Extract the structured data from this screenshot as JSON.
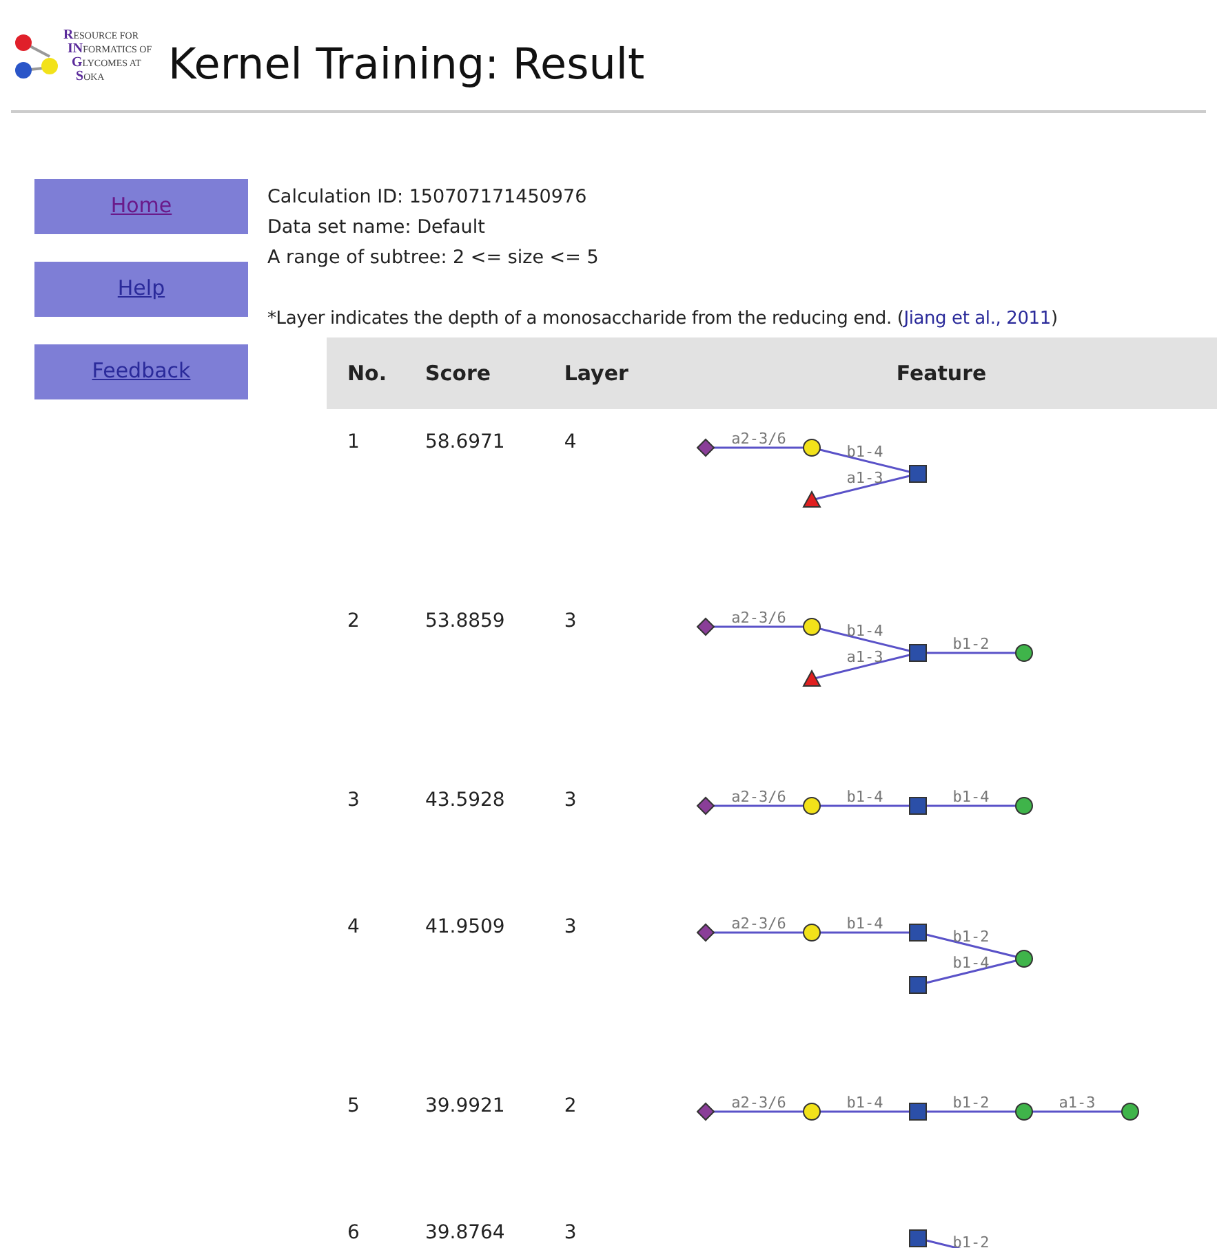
{
  "logo": {
    "lines": [
      {
        "lead": "R",
        "rest": "ESOURCE FOR"
      },
      {
        "lead": "IN",
        "rest": "FORMATICS OF"
      },
      {
        "lead": "G",
        "rest": "LYCOMES AT"
      },
      {
        "lead": "S",
        "rest": "OKA"
      }
    ]
  },
  "title": "Kernel Training: Result",
  "nav": [
    "Home",
    "Help",
    "Feedback"
  ],
  "info": [
    "Calculation ID: 150707171450976",
    "Data set name: Default",
    "A range of subtree: 2 <= size <= 5"
  ],
  "note": {
    "text": "*Layer indicates the depth of a monosaccharide from the reducing end. (",
    "link": "Jiang et al., 2011",
    "after": ")"
  },
  "table": {
    "columns": [
      "No.",
      "Score",
      "Layer",
      "Feature"
    ],
    "rows": [
      {
        "no": "1",
        "score": "58.6971",
        "layer": "4",
        "feature": {
          "tree": {
            "kind": "square",
            "children": [
              {
                "kind": "circle",
                "color": "#f2e21a",
                "link": "b1-4",
                "children": [
                  {
                    "kind": "diamond",
                    "link": "a2-3/6"
                  }
                ]
              },
              {
                "kind": "triangle",
                "link": "a1-3"
              }
            ]
          }
        }
      },
      {
        "no": "2",
        "score": "53.8859",
        "layer": "3",
        "feature": {
          "tree": {
            "kind": "circle",
            "color": "#3fb44a",
            "children": [
              {
                "kind": "square",
                "link": "b1-2",
                "children": [
                  {
                    "kind": "circle",
                    "color": "#f2e21a",
                    "link": "b1-4",
                    "children": [
                      {
                        "kind": "diamond",
                        "link": "a2-3/6"
                      }
                    ]
                  },
                  {
                    "kind": "triangle",
                    "link": "a1-3"
                  }
                ]
              }
            ]
          }
        }
      },
      {
        "no": "3",
        "score": "43.5928",
        "layer": "3",
        "feature": {
          "tree": {
            "kind": "circle",
            "color": "#3fb44a",
            "children": [
              {
                "kind": "square",
                "link": "b1-4",
                "children": [
                  {
                    "kind": "circle",
                    "color": "#f2e21a",
                    "link": "b1-4",
                    "children": [
                      {
                        "kind": "diamond",
                        "link": "a2-3/6"
                      }
                    ]
                  }
                ]
              }
            ]
          }
        }
      },
      {
        "no": "4",
        "score": "41.9509",
        "layer": "3",
        "feature": {
          "tree": {
            "kind": "circle",
            "color": "#3fb44a",
            "children": [
              {
                "kind": "square",
                "link": "b1-2",
                "children": [
                  {
                    "kind": "circle",
                    "color": "#f2e21a",
                    "link": "b1-4",
                    "children": [
                      {
                        "kind": "diamond",
                        "link": "a2-3/6"
                      }
                    ]
                  }
                ]
              },
              {
                "kind": "square",
                "link": "b1-4"
              }
            ]
          }
        }
      },
      {
        "no": "5",
        "score": "39.9921",
        "layer": "2",
        "feature": {
          "tree": {
            "kind": "circle",
            "color": "#3fb44a",
            "children": [
              {
                "kind": "circle",
                "color": "#3fb44a",
                "link": "a1-3",
                "children": [
                  {
                    "kind": "square",
                    "link": "b1-2",
                    "children": [
                      {
                        "kind": "circle",
                        "color": "#f2e21a",
                        "link": "b1-4",
                        "children": [
                          {
                            "kind": "diamond",
                            "link": "a2-3/6"
                          }
                        ]
                      }
                    ]
                  }
                ]
              }
            ]
          }
        }
      },
      {
        "no": "6",
        "score": "39.8764",
        "layer": "3",
        "feature": {
          "tree": {
            "kind": "square",
            "link": "b1-2"
          }
        }
      }
    ]
  }
}
